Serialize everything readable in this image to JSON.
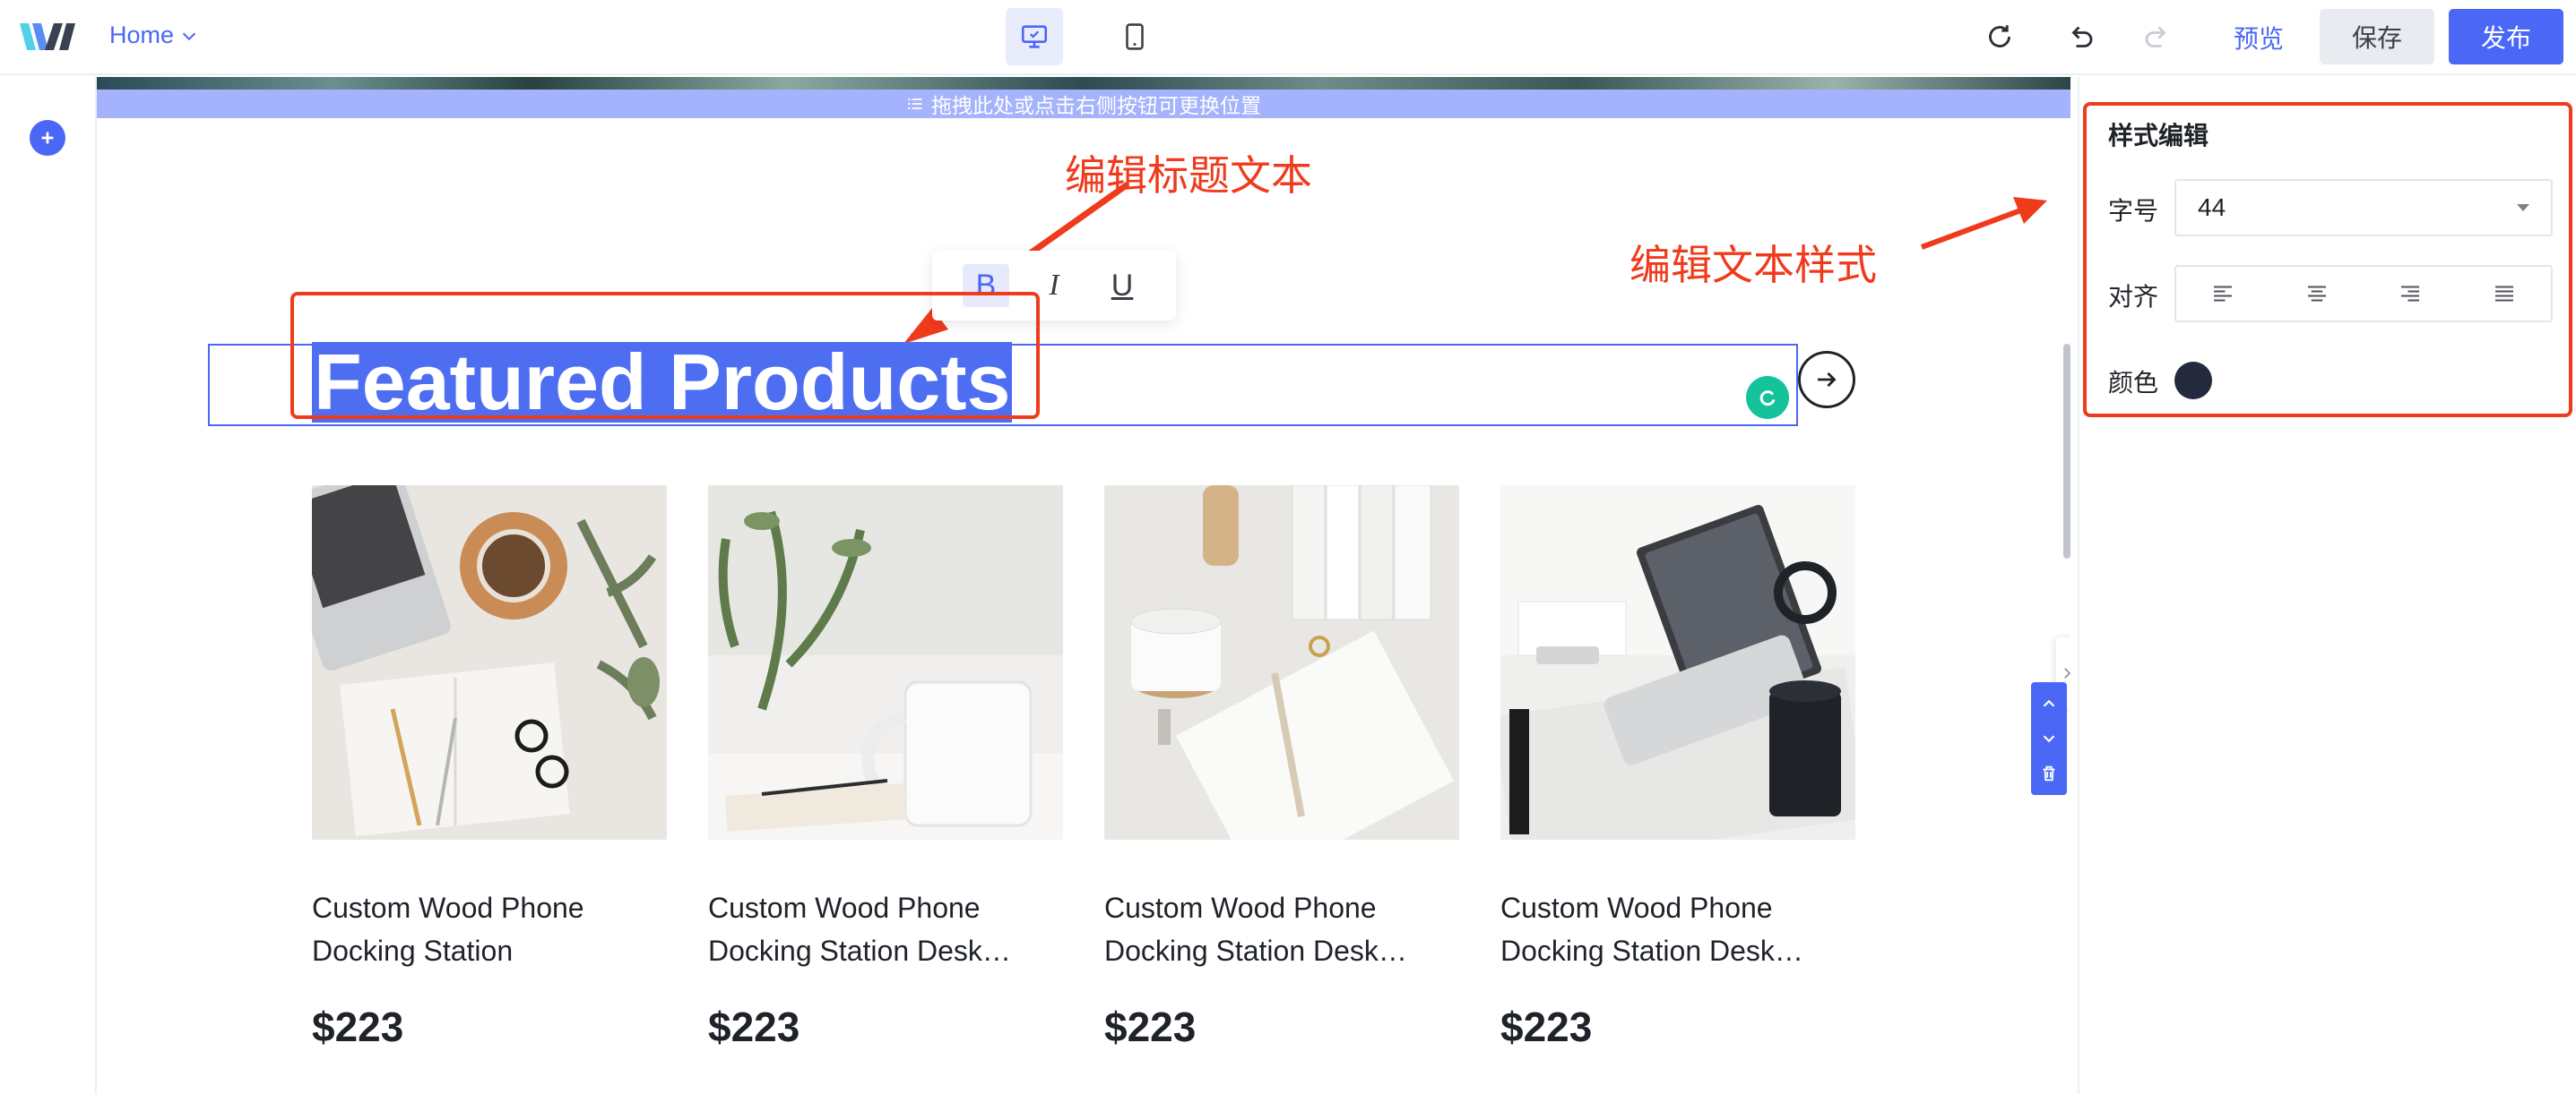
{
  "topbar": {
    "page_select": "Home",
    "preview": "预览",
    "save": "保存",
    "publish": "发布",
    "icons": [
      "logo",
      "chevron-down-icon",
      "desktop-icon",
      "mobile-icon",
      "refresh-icon",
      "undo-icon",
      "redo-icon"
    ]
  },
  "canvas": {
    "drag_hint": "拖拽此处或点击右侧按钮可更换位置",
    "annotation_title": "编辑标题文本",
    "annotation_style": "编辑文本样式",
    "format_toolbar": {
      "bold": "B",
      "italic": "I",
      "underline": "U",
      "active": "bold"
    },
    "section_title": "Featured Products",
    "products": [
      {
        "name": "Custom Wood Phone Docking Station",
        "price": "$223"
      },
      {
        "name": "Custom Wood Phone Docking Station Desk…",
        "price": "$223"
      },
      {
        "name": "Custom Wood Phone Docking Station Desk…",
        "price": "$223"
      },
      {
        "name": "Custom Wood Phone Docking Station Desk…",
        "price": "$223"
      }
    ]
  },
  "style_panel": {
    "title": "样式编辑",
    "font_size_label": "字号",
    "font_size_value": "44",
    "align_label": "对齐",
    "align_options": [
      "left",
      "center",
      "right",
      "justify"
    ],
    "color_label": "颜色",
    "color_value": "#232a3d"
  },
  "colors": {
    "accent": "#4a67f5",
    "annotation": "#f03a1c"
  }
}
